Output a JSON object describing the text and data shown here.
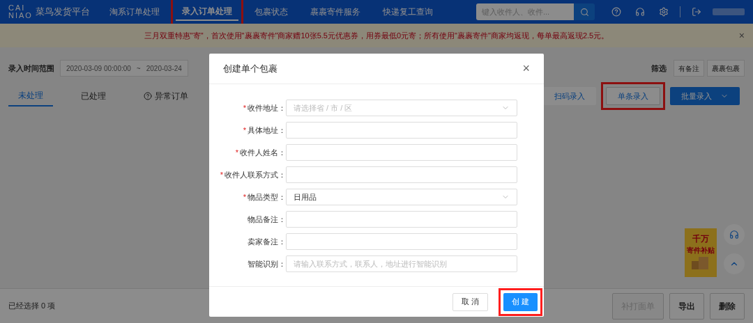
{
  "header": {
    "logo_top": "CAI",
    "logo_bottom": "NIAO",
    "brand": "菜鸟发货平台",
    "nav": [
      {
        "label": "淘系订单处理",
        "selected": false,
        "highlighted": false
      },
      {
        "label": "录入订单处理",
        "selected": true,
        "highlighted": true
      },
      {
        "label": "包裹状态",
        "selected": false,
        "highlighted": false
      },
      {
        "label": "裹裹寄件服务",
        "selected": false,
        "highlighted": false
      },
      {
        "label": "快递复工查询",
        "selected": false,
        "highlighted": false
      }
    ],
    "search": {
      "placeholder": "键入收件人、收件..."
    }
  },
  "notice": {
    "text": "三月双重特惠\"寄\"，首次使用\"裹裹寄件\"商家赠10张5.5元优惠券，用券最低0元寄；所有使用\"裹裹寄件\"商家均返现，每单最高返现2.5元。",
    "close": "×"
  },
  "filters": {
    "date_label": "录入时间范围",
    "start": "2020-03-09 00:00:00",
    "separator": "~",
    "end": "2020-03-24",
    "filter_label": "筛选",
    "chips": [
      "有备注",
      "裹裹包裹"
    ]
  },
  "tabs": [
    {
      "label": "未处理",
      "selected": true,
      "help": false
    },
    {
      "label": "已处理",
      "selected": false,
      "help": false
    },
    {
      "label": "异常订单",
      "selected": false,
      "help": true
    }
  ],
  "actions": [
    {
      "label": "扫码录入",
      "kind": "link",
      "highlighted": false
    },
    {
      "label": "单条录入",
      "kind": "outline",
      "highlighted": true
    },
    {
      "label": "批量录入",
      "kind": "primary",
      "highlighted": false
    }
  ],
  "promo": {
    "title": "千万",
    "subtitle": "寄件补贴"
  },
  "footer": {
    "selected_count": "已经选择 0 项",
    "buttons": [
      {
        "label": "补打面单",
        "disabled": true
      },
      {
        "label": "导出",
        "disabled": false
      },
      {
        "label": "删除",
        "disabled": false
      }
    ]
  },
  "dialog": {
    "title": "创建单个包裹",
    "close": "×",
    "required_mark": "*",
    "fields": [
      {
        "label": "收件地址：",
        "required": true,
        "kind": "select",
        "placeholder": "请选择省 / 市 / 区"
      },
      {
        "label": "具体地址：",
        "required": true,
        "kind": "input"
      },
      {
        "label": "收件人姓名：",
        "required": true,
        "kind": "input"
      },
      {
        "label": "收件人联系方式：",
        "required": true,
        "kind": "input"
      },
      {
        "label": "物品类型：",
        "required": true,
        "kind": "select",
        "value": "日用品"
      },
      {
        "label": "物品备注：",
        "required": false,
        "kind": "input"
      },
      {
        "label": "卖家备注：",
        "required": false,
        "kind": "input"
      },
      {
        "label": "智能识别：",
        "required": false,
        "kind": "input",
        "placeholder": "请输入联系方式，联系人，地址进行智能识别"
      }
    ],
    "buttons": [
      {
        "label": "取 消",
        "kind": "default",
        "highlighted": false
      },
      {
        "label": "创 建",
        "kind": "primary",
        "highlighted": true
      }
    ]
  }
}
